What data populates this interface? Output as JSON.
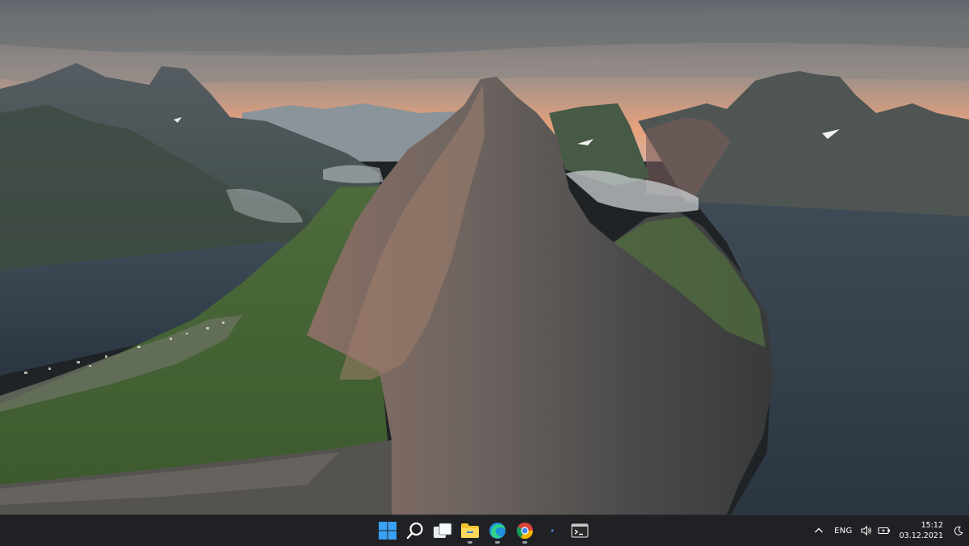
{
  "taskbar": {
    "apps": [
      {
        "name": "Start",
        "icon": "windows-start-icon"
      },
      {
        "name": "Search",
        "icon": "search-icon"
      },
      {
        "name": "Task View",
        "icon": "task-view-icon"
      },
      {
        "name": "File Explorer",
        "icon": "folder-icon"
      },
      {
        "name": "Microsoft Edge",
        "icon": "edge-browser-icon"
      },
      {
        "name": "Google Chrome",
        "icon": "chrome-browser-icon"
      },
      {
        "name": "Dot",
        "icon": "small-dot-icon"
      },
      {
        "name": "Terminal",
        "icon": "terminal-icon"
      }
    ],
    "tray": {
      "language": "ENG",
      "time": "15:12",
      "date": "03.12.2021"
    }
  },
  "colors": {
    "taskbar_bg": "#202124",
    "accent_blue": "#3aa0f3",
    "folder_yellow": "#f4c430"
  }
}
